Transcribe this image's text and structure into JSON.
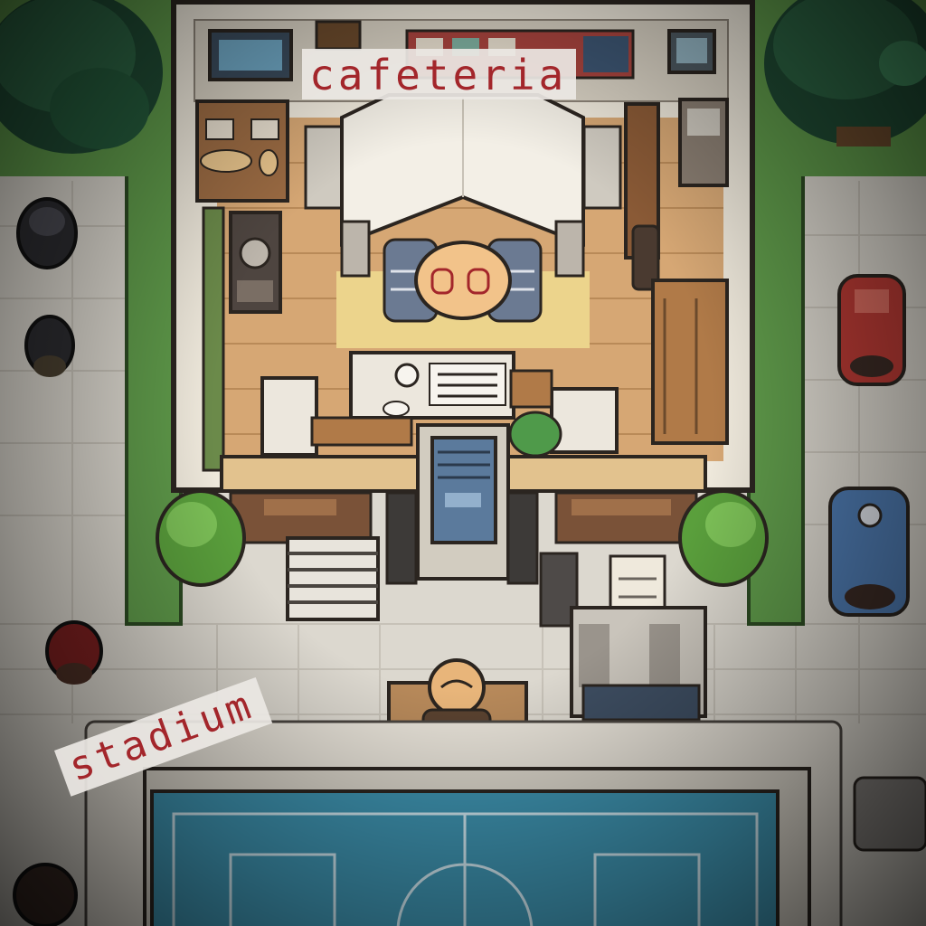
{
  "map": {
    "labels": {
      "cafeteria": "cafeteria",
      "stadium": "stadium"
    },
    "colors": {
      "grass": "#5f9a4a",
      "floor_wood": "#d6a774",
      "wall": "#efe9dc",
      "court": "#3e93b0",
      "pavement": "#dcd8cf",
      "label_text": "#a3262b"
    },
    "icons": [
      "tree-icon",
      "bush-icon",
      "npc-icon",
      "player-icon",
      "trash-bin-icon",
      "table-icon",
      "stairs-icon",
      "door-icon"
    ]
  }
}
